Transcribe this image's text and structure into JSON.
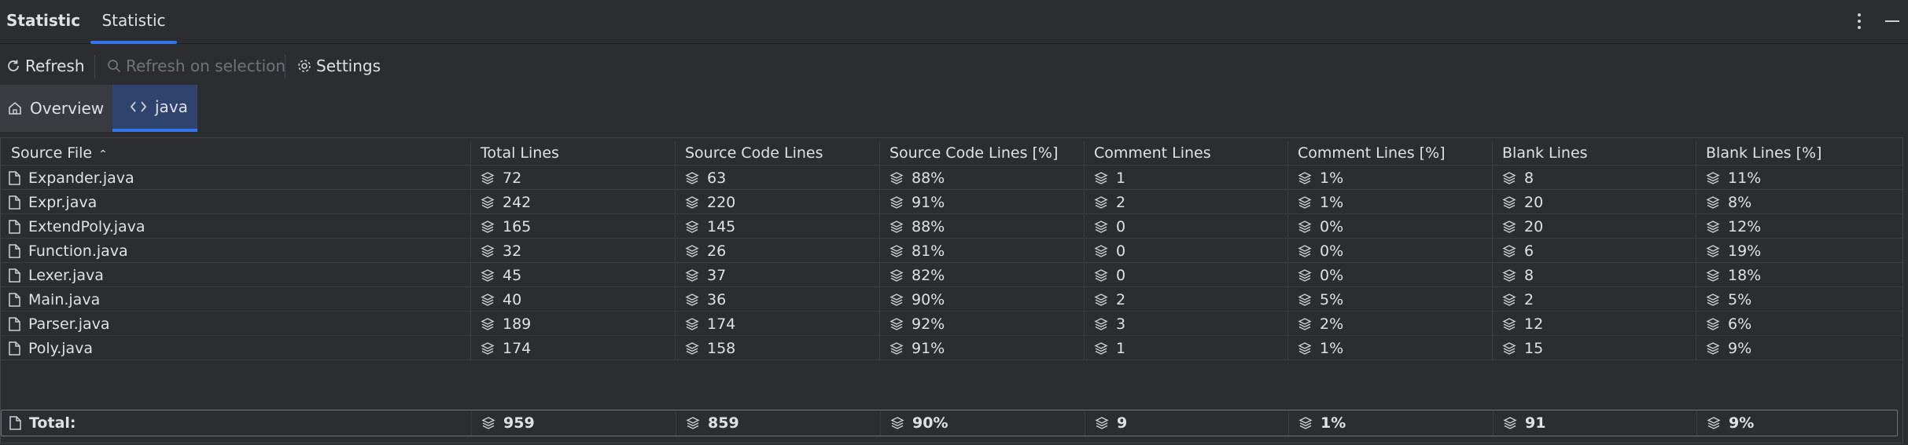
{
  "toolwindow": {
    "title": "Statistic",
    "tab": "Statistic"
  },
  "toolbar": {
    "refresh": "Refresh",
    "refresh_selection": "Refresh on selection",
    "settings": "Settings"
  },
  "view_tabs": {
    "overview": "Overview",
    "java": "java"
  },
  "table": {
    "columns": [
      "Source File",
      "Total Lines",
      "Source Code Lines",
      "Source Code Lines [%]",
      "Comment Lines",
      "Comment Lines [%]",
      "Blank Lines",
      "Blank Lines [%]"
    ],
    "rows": [
      [
        "Expander.java",
        "72",
        "63",
        "88%",
        "1",
        "1%",
        "8",
        "11%"
      ],
      [
        "Expr.java",
        "242",
        "220",
        "91%",
        "2",
        "1%",
        "20",
        "8%"
      ],
      [
        "ExtendPoly.java",
        "165",
        "145",
        "88%",
        "0",
        "0%",
        "20",
        "12%"
      ],
      [
        "Function.java",
        "32",
        "26",
        "81%",
        "0",
        "0%",
        "6",
        "19%"
      ],
      [
        "Lexer.java",
        "45",
        "37",
        "82%",
        "0",
        "0%",
        "8",
        "18%"
      ],
      [
        "Main.java",
        "40",
        "36",
        "90%",
        "2",
        "5%",
        "2",
        "5%"
      ],
      [
        "Parser.java",
        "189",
        "174",
        "92%",
        "3",
        "2%",
        "12",
        "6%"
      ],
      [
        "Poly.java",
        "174",
        "158",
        "91%",
        "1",
        "1%",
        "15",
        "9%"
      ]
    ],
    "total": [
      "Total:",
      "959",
      "859",
      "90%",
      "9",
      "1%",
      "91",
      "9%"
    ]
  },
  "icons": {
    "file": "file-icon",
    "value": "layers-icon",
    "refresh": "refresh-icon",
    "search": "search-icon",
    "settings": "gear-icon",
    "home": "home-icon",
    "code": "code-icon"
  },
  "colors": {
    "accent": "#3574f0",
    "background": "#2b2d30",
    "selected_tab": "#2e436e"
  }
}
